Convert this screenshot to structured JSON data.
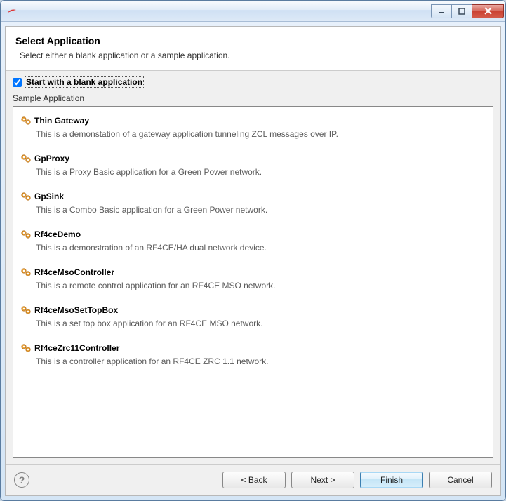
{
  "window": {
    "title": ""
  },
  "header": {
    "title": "Select Application",
    "subtitle": "Select either a blank application or a sample application."
  },
  "options": {
    "blank_checkbox_label": "Start with a blank application",
    "blank_checked": true
  },
  "section_label": "Sample Application",
  "samples": [
    {
      "name": "Thin Gateway",
      "desc": "This is a demonstation of a gateway application tunneling ZCL messages over IP."
    },
    {
      "name": "GpProxy",
      "desc": "This is a Proxy Basic application for a Green Power network."
    },
    {
      "name": "GpSink",
      "desc": "This is a Combo Basic application for a Green Power network."
    },
    {
      "name": "Rf4ceDemo",
      "desc": "This is a demonstration of an RF4CE/HA dual network device."
    },
    {
      "name": "Rf4ceMsoController",
      "desc": "This is a remote control application for an RF4CE MSO network."
    },
    {
      "name": "Rf4ceMsoSetTopBox",
      "desc": "This is a set top box application for an RF4CE MSO network."
    },
    {
      "name": "Rf4ceZrc11Controller",
      "desc": "This is a controller application for an RF4CE ZRC 1.1 network."
    }
  ],
  "footer": {
    "back": "< Back",
    "next": "Next >",
    "finish": "Finish",
    "cancel": "Cancel"
  }
}
